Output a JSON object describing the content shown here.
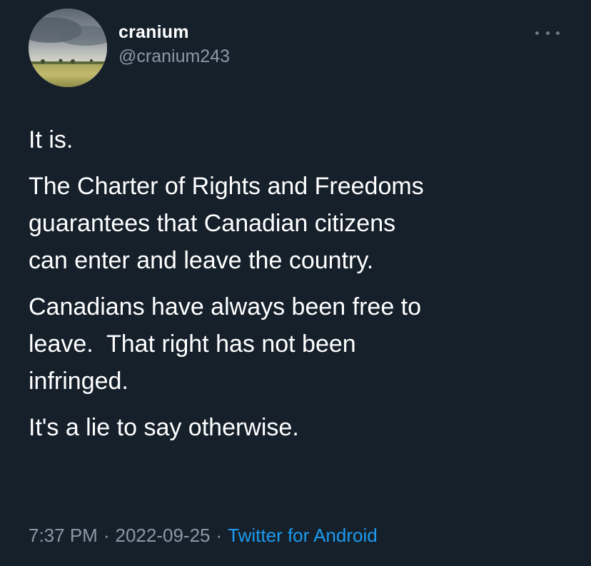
{
  "author": {
    "display_name": "cranium",
    "handle": "@cranium243",
    "avatar_icon": "landscape-avatar"
  },
  "menu": {
    "icon": "more-horizontal-icon"
  },
  "tweet": {
    "paragraphs": [
      "It is.",
      "The Charter of Rights and Freedoms\nguarantees that Canadian citizens\ncan enter and leave the country.",
      "Canadians have always been free to\nleave.  That right has not been\ninfringed.",
      "It's a lie to say otherwise."
    ]
  },
  "meta": {
    "time": "7:37 PM",
    "separator": "·",
    "date": "2022-09-25",
    "source": "Twitter for Android"
  },
  "colors": {
    "background": "#15202b",
    "text": "#ffffff",
    "secondary_text": "#8b98a5",
    "link": "#1d9bf0"
  }
}
